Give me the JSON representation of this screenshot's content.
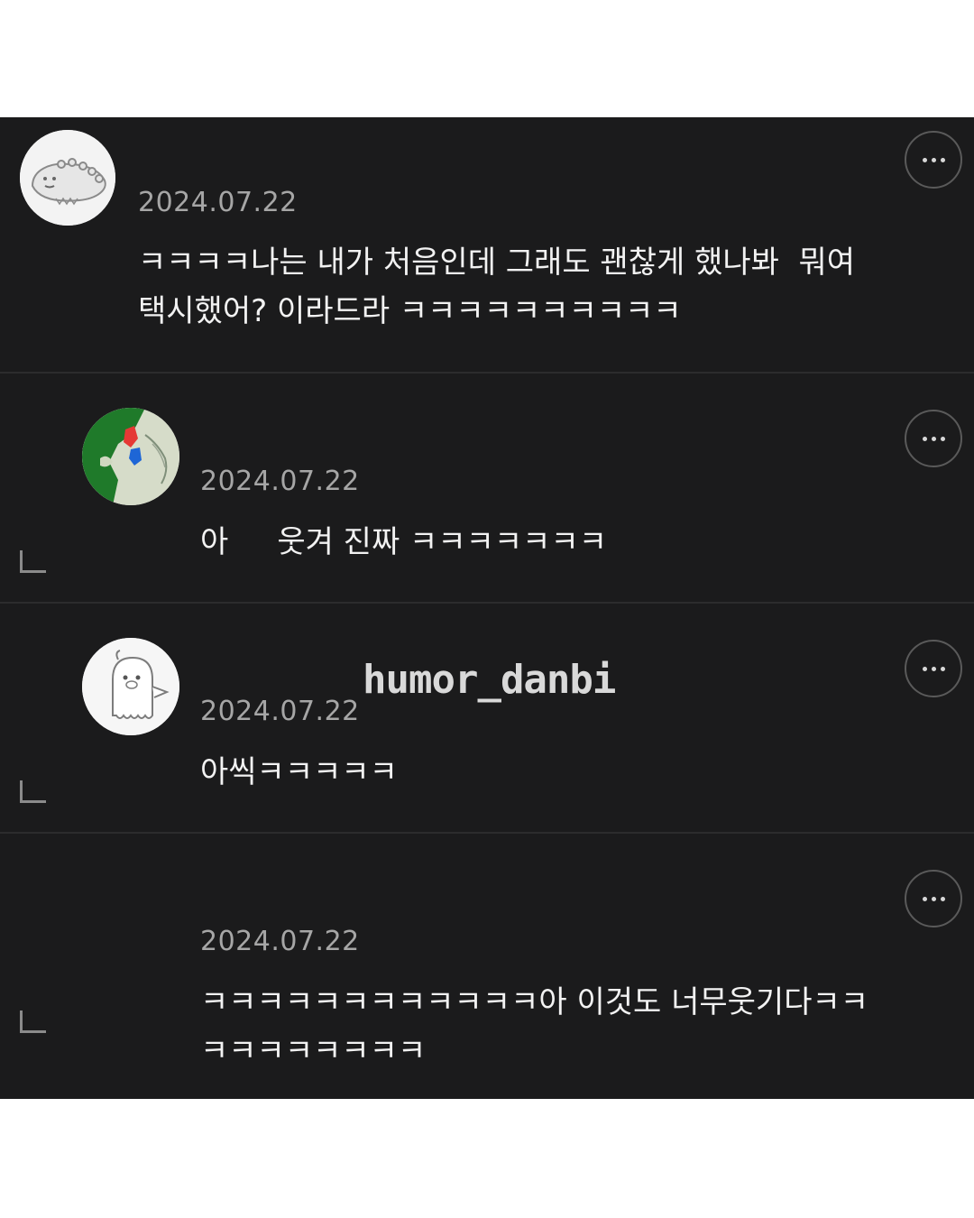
{
  "comments": [
    {
      "date": "2024.07.22",
      "text": "ㅋㅋㅋㅋ나는 내가 처음인데 그래도 괜찮게 했나봐  뭐여\n택시했어? 이라드라 ㅋㅋㅋㅋㅋㅋㅋㅋㅋㅋ",
      "is_reply": false,
      "avatar": "dinosaur-avatar"
    },
    {
      "date": "2024.07.22",
      "text": "아     웃겨 진짜 ㅋㅋㅋㅋㅋㅋㅋ",
      "is_reply": true,
      "avatar": "korea-map-avatar"
    },
    {
      "date": "2024.07.22",
      "text": "아씩ㅋㅋㅋㅋㅋ",
      "is_reply": true,
      "avatar": "ghost-character-avatar"
    },
    {
      "date": "2024.07.22",
      "text": "ㅋㅋㅋㅋㅋㅋㅋㅋㅋㅋㅋㅋ아 이것도 너무웃기다ㅋㅋ\nㅋㅋㅋㅋㅋㅋㅋㅋ",
      "is_reply": true,
      "avatar": null
    }
  ],
  "watermark": "humor_danbi",
  "icons": {
    "more": "more-options-icon",
    "reply": "reply-arrow-icon"
  },
  "colors": {
    "background": "#1b1b1c",
    "text": "#f2f2f2",
    "date": "#a6a6a6"
  }
}
